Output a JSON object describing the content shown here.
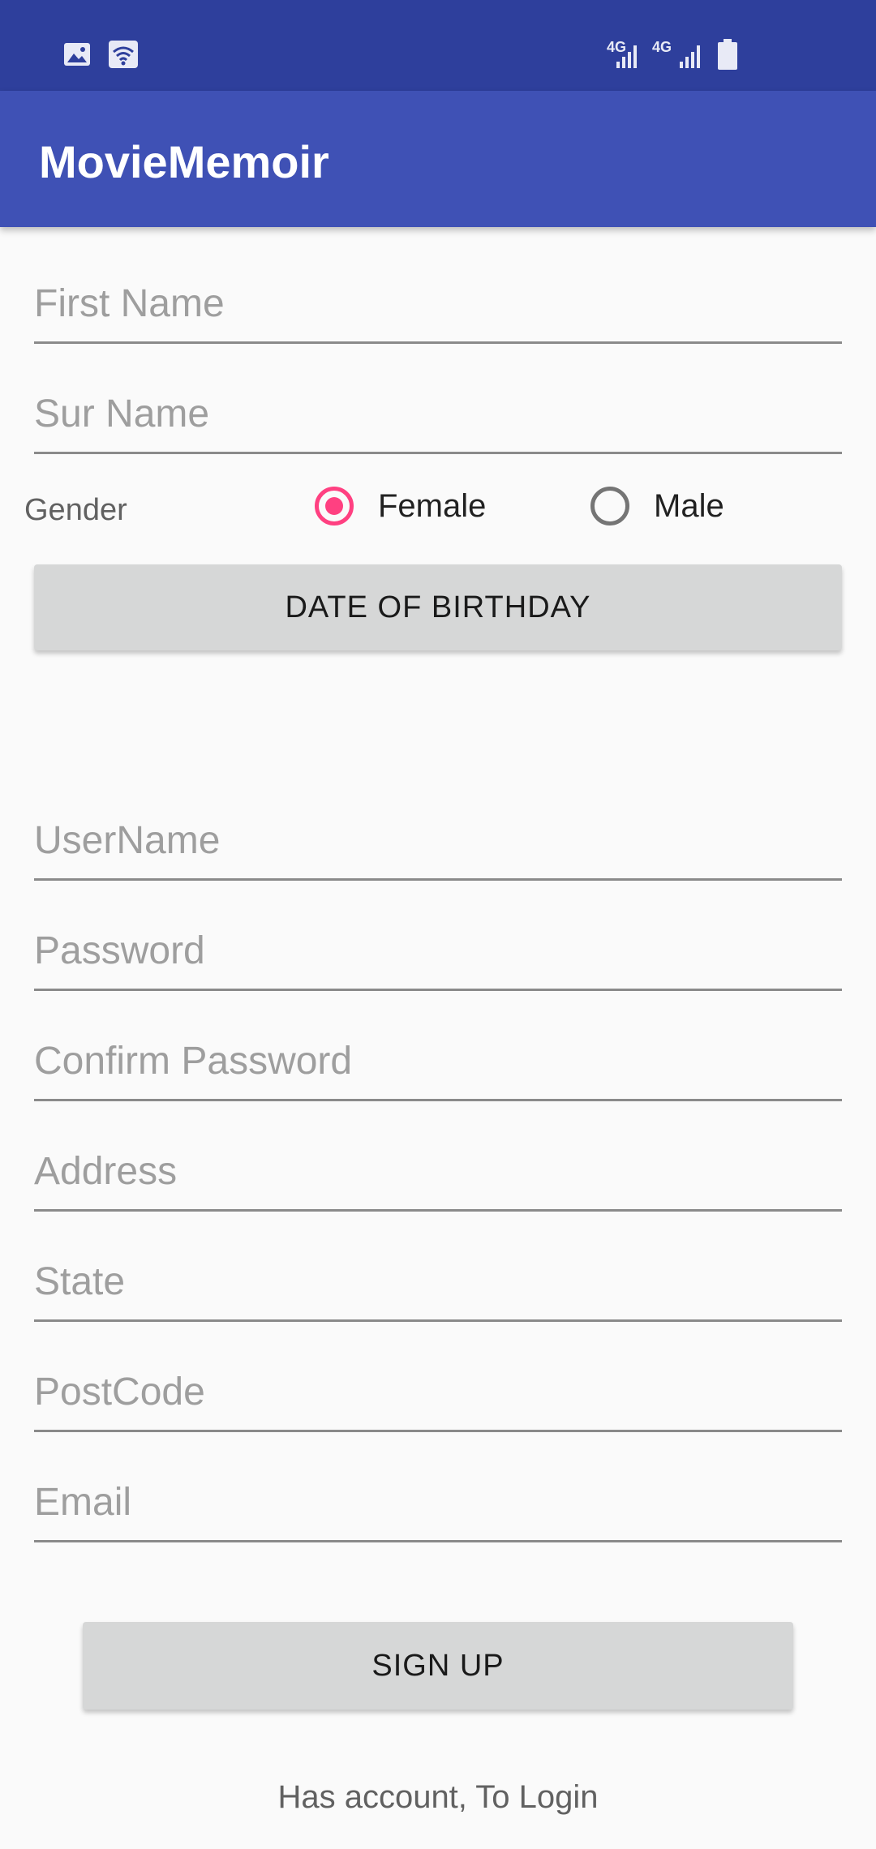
{
  "app": {
    "title": "MovieMemoir"
  },
  "statusbar": {
    "network_1": "4G",
    "network_2": "4G",
    "icons": [
      "image-icon",
      "wifi-icon",
      "signal-icon",
      "signal-icon",
      "battery-icon"
    ]
  },
  "form": {
    "first_name": {
      "placeholder": "First Name",
      "value": ""
    },
    "sur_name": {
      "placeholder": "Sur Name",
      "value": ""
    },
    "gender": {
      "label": "Gender",
      "options": [
        "Female",
        "Male"
      ],
      "selected": "Female"
    },
    "dob_button": "DATE OF BIRTHDAY",
    "username": {
      "placeholder": "UserName",
      "value": ""
    },
    "password": {
      "placeholder": "Password",
      "value": ""
    },
    "confirm_password": {
      "placeholder": "Confirm Password",
      "value": ""
    },
    "address": {
      "placeholder": "Address",
      "value": ""
    },
    "state": {
      "placeholder": "State",
      "value": ""
    },
    "postcode": {
      "placeholder": "PostCode",
      "value": ""
    },
    "email": {
      "placeholder": "Email",
      "value": ""
    },
    "signup_button": "SIGN UP",
    "login_link": "Has account, To Login"
  },
  "colors": {
    "statusbar": "#2e3f9c",
    "appbar": "#3f51b5",
    "radio_selected": "#ff4081",
    "radio_unselected": "#757575"
  }
}
